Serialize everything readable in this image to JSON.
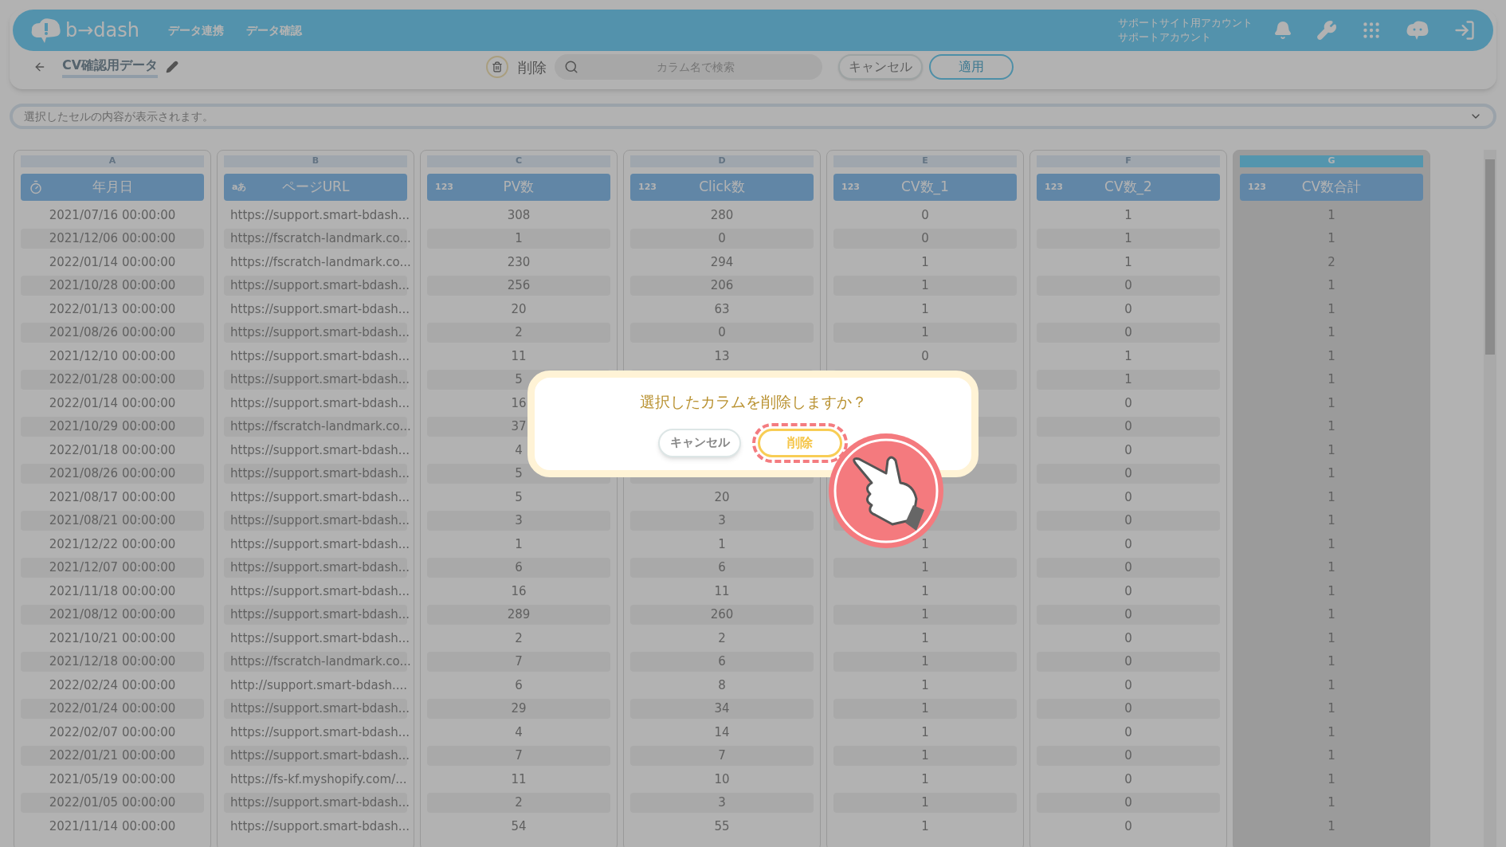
{
  "header": {
    "logo": "b→dash",
    "nav": [
      {
        "label": "データ連携"
      },
      {
        "label": "データ確認"
      }
    ],
    "account": {
      "line1": "サポートサイト用アカウント",
      "line2": "サポートアカウント"
    }
  },
  "toolbar": {
    "title": "CV確認用データ",
    "delete_label": "削除",
    "search_placeholder": "カラム名で検索",
    "cancel": "キャンセル",
    "apply": "適用"
  },
  "cell_info": {
    "placeholder": "選択したセルの内容が表示されます。"
  },
  "table": {
    "columns": [
      {
        "letter": "A",
        "title": "年月日",
        "kind": "date",
        "selected": false
      },
      {
        "letter": "B",
        "title": "ページURL",
        "kind": "text",
        "type_label": "aあ",
        "selected": false
      },
      {
        "letter": "C",
        "title": "PV数",
        "kind": "number",
        "type_label": "123",
        "selected": false
      },
      {
        "letter": "D",
        "title": "Click数",
        "kind": "number",
        "type_label": "123",
        "selected": false
      },
      {
        "letter": "E",
        "title": "CV数_1",
        "kind": "number",
        "type_label": "123",
        "selected": false
      },
      {
        "letter": "F",
        "title": "CV数_2",
        "kind": "number",
        "type_label": "123",
        "selected": false
      },
      {
        "letter": "G",
        "title": "CV数合計",
        "kind": "number",
        "type_label": "123",
        "selected": true
      }
    ],
    "rows": [
      [
        "2021/07/16 00:00:00",
        "https://support.smart-bdash...",
        "308",
        "280",
        "0",
        "1",
        "1"
      ],
      [
        "2021/12/06 00:00:00",
        "https://fscratch-landmark.co...",
        "1",
        "0",
        "0",
        "1",
        "1"
      ],
      [
        "2022/01/14 00:00:00",
        "https://fscratch-landmark.co...",
        "230",
        "294",
        "1",
        "1",
        "2"
      ],
      [
        "2021/10/28 00:00:00",
        "https://support.smart-bdash...",
        "256",
        "206",
        "1",
        "0",
        "1"
      ],
      [
        "2022/01/13 00:00:00",
        "https://support.smart-bdash...",
        "20",
        "63",
        "1",
        "0",
        "1"
      ],
      [
        "2021/08/26 00:00:00",
        "https://support.smart-bdash...",
        "2",
        "0",
        "1",
        "0",
        "1"
      ],
      [
        "2021/12/10 00:00:00",
        "https://support.smart-bdash...",
        "11",
        "13",
        "0",
        "1",
        "1"
      ],
      [
        "2022/01/28 00:00:00",
        "https://support.smart-bdash...",
        "5",
        null,
        null,
        "1",
        "1"
      ],
      [
        "2022/01/14 00:00:00",
        "https://support.smart-bdash...",
        "16",
        null,
        null,
        "0",
        "1"
      ],
      [
        "2021/10/29 00:00:00",
        "https://fscratch-landmark.co...",
        "37",
        null,
        null,
        "0",
        "1"
      ],
      [
        "2022/01/18 00:00:00",
        "https://support.smart-bdash...",
        "4",
        null,
        null,
        "0",
        "1"
      ],
      [
        "2021/08/26 00:00:00",
        "https://support.smart-bdash...",
        "5",
        null,
        null,
        "0",
        "1"
      ],
      [
        "2021/08/17 00:00:00",
        "https://support.smart-bdash...",
        "5",
        "20",
        null,
        "0",
        "1"
      ],
      [
        "2021/08/21 00:00:00",
        "https://support.smart-bdash...",
        "3",
        "3",
        null,
        "0",
        "1"
      ],
      [
        "2021/12/22 00:00:00",
        "https://support.smart-bdash...",
        "1",
        "1",
        "1",
        "0",
        "1"
      ],
      [
        "2021/12/07 00:00:00",
        "https://support.smart-bdash...",
        "6",
        "6",
        "1",
        "0",
        "1"
      ],
      [
        "2021/11/18 00:00:00",
        "https://support.smart-bdash...",
        "16",
        "11",
        "1",
        "0",
        "1"
      ],
      [
        "2021/08/12 00:00:00",
        "https://support.smart-bdash...",
        "289",
        "260",
        "1",
        "0",
        "1"
      ],
      [
        "2021/10/21 00:00:00",
        "https://support.smart-bdash...",
        "2",
        "2",
        "1",
        "0",
        "1"
      ],
      [
        "2021/12/18 00:00:00",
        "https://fscratch-landmark.co...",
        "7",
        "6",
        "1",
        "0",
        "1"
      ],
      [
        "2022/02/24 00:00:00",
        "http://support.smart-bdash....",
        "6",
        "8",
        "1",
        "0",
        "1"
      ],
      [
        "2022/01/24 00:00:00",
        "https://support.smart-bdash...",
        "29",
        "34",
        "1",
        "0",
        "1"
      ],
      [
        "2022/02/07 00:00:00",
        "https://support.smart-bdash...",
        "4",
        "14",
        "1",
        "0",
        "1"
      ],
      [
        "2022/01/21 00:00:00",
        "https://support.smart-bdash...",
        "7",
        "7",
        "1",
        "0",
        "1"
      ],
      [
        "2021/05/19 00:00:00",
        "https://fs-kf.myshopify.com/...",
        "11",
        "10",
        "1",
        "0",
        "1"
      ],
      [
        "2022/01/05 00:00:00",
        "https://support.smart-bdash...",
        "2",
        "3",
        "1",
        "0",
        "1"
      ],
      [
        "2021/11/14 00:00:00",
        "https://support.smart-bdash...",
        "54",
        "55",
        "1",
        "0",
        "1"
      ]
    ]
  },
  "modal": {
    "message": "選択したカラムを削除しますか？",
    "cancel": "キャンセル",
    "confirm": "削除",
    "confirm_highlighted": true
  }
}
